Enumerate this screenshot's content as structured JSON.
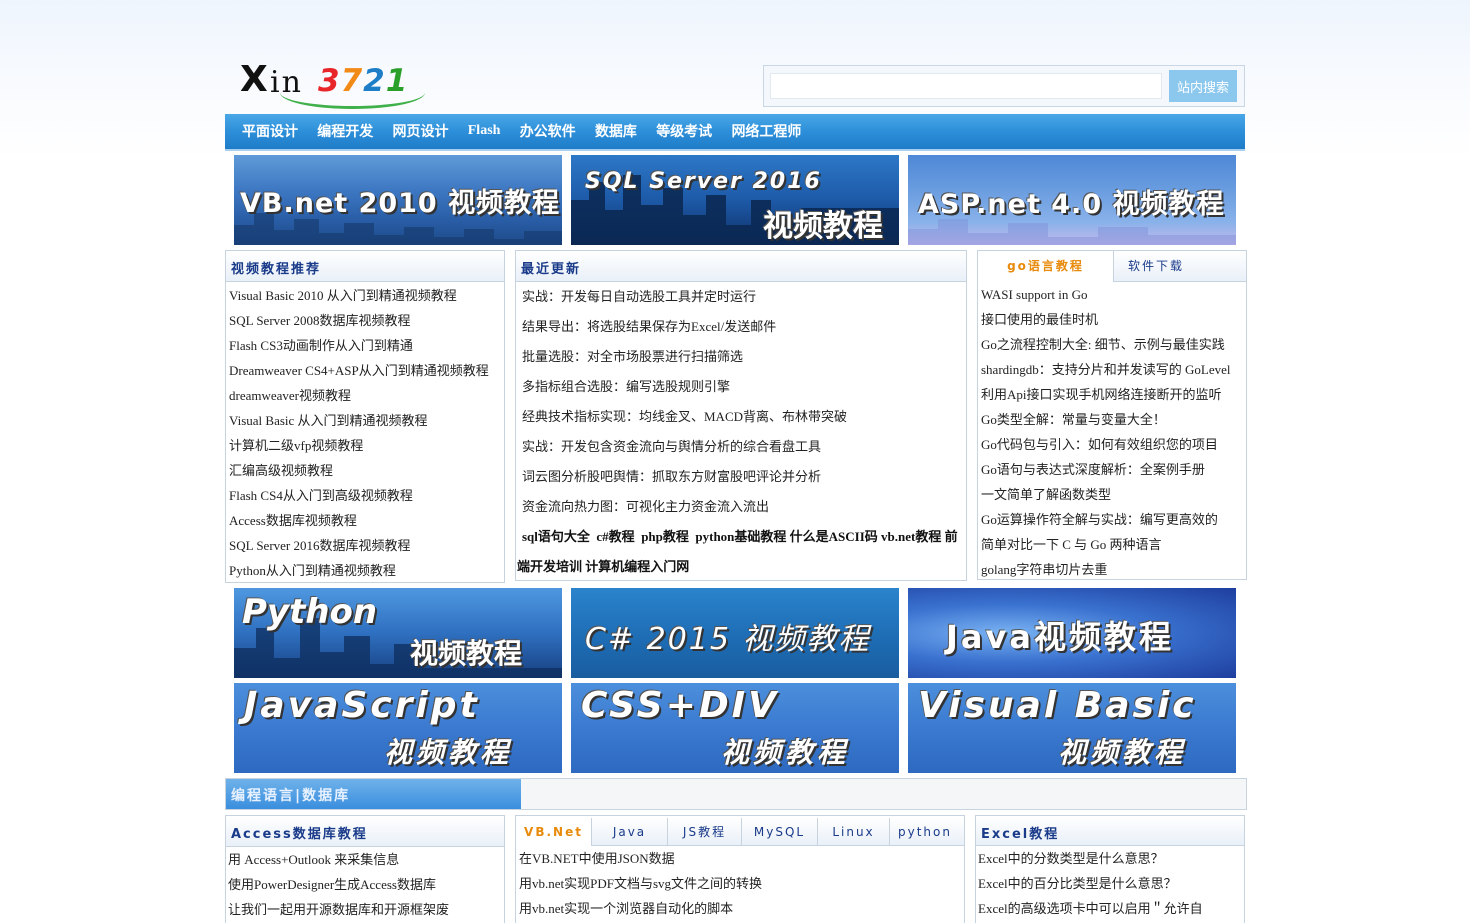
{
  "logo": {
    "x_text": "X",
    "in_text": "in",
    "num_digits": [
      "3",
      "7",
      "2",
      "1"
    ]
  },
  "search": {
    "placeholder": "",
    "button_label": "站内搜索"
  },
  "nav": {
    "items": [
      "平面设计",
      "编程开发",
      "网页设计",
      "Flash",
      "办公软件",
      "数据库",
      "等级考试",
      "网络工程师"
    ]
  },
  "banners_top": [
    {
      "line1": "VB.net 2010 视频教程",
      "line2": ""
    },
    {
      "line1": "SQL Server 2016",
      "line2": "视频教程"
    },
    {
      "line1": "ASP.net 4.0 视频教程",
      "line2": ""
    }
  ],
  "video_box": {
    "title": "视频教程推荐",
    "items": [
      "Visual Basic 2010 从入门到精通视频教程",
      "SQL Server 2008数据库视频教程",
      "Flash CS3动画制作从入门到精通",
      "Dreamweaver CS4+ASP从入门到精通视频教程",
      "dreamweaver视频教程",
      "Visual Basic 从入门到精通视频教程",
      "计算机二级vfp视频教程",
      "汇编高级视频教程",
      "Flash CS4从入门到高级视频教程",
      "Access数据库视频教程",
      "SQL Server 2016数据库视频教程",
      "Python从入门到精通视频教程"
    ]
  },
  "recent_box": {
    "title": "最近更新",
    "items": [
      "实战：开发每日自动选股工具并定时运行",
      "结果导出：将选股结果保存为Excel/发送邮件",
      "批量选股：对全市场股票进行扫描筛选",
      "多指标组合选股：编写选股规则引擎",
      "经典技术指标实现：均线金叉、MACD背离、布林带突破",
      "实战：开发包含资金流向与舆情分析的综合看盘工具",
      "词云图分析股吧舆情：抓取东方财富股吧评论并分析",
      "资金流向热力图：可视化主力资金流入流出"
    ],
    "keywords_line1": [
      "sql语句大全",
      "c#教程",
      "php教程",
      "python基础教程",
      "什么是ASCII码",
      "vb.net教程",
      "前"
    ],
    "keywords_line2": [
      "端开发培训",
      "计算机编程入门网"
    ]
  },
  "go_box": {
    "tabs": [
      "go语言教程",
      "软件下载"
    ],
    "items": [
      "WASI support in Go",
      "接口使用的最佳时机",
      "Go之流程控制大全: 细节、示例与最佳实践",
      "shardingdb：支持分片和并发读写的 GoLevel",
      "利用Api接口实现手机网络连接断开的监听",
      "Go类型全解：常量与变量大全！",
      "Go代码包与引入：如何有效组织您的项目",
      "Go语句与表达式深度解析：全案例手册",
      "一文简单了解函数类型",
      "Go运算操作符全解与实战：编写更高效的",
      "简单对比一下 C 与 Go 两种语言",
      "golang字符串切片去重"
    ]
  },
  "banners_mid": [
    {
      "line1": "Python",
      "line2": "视频教程"
    },
    {
      "line1": "C# 2015 视频教程",
      "line2": ""
    },
    {
      "line1": "Java视频教程",
      "line2": ""
    },
    {
      "line1": "JavaScript",
      "line2": "视频教程"
    },
    {
      "line1": "CSS+DIV",
      "line2": "视频教程"
    },
    {
      "line1": "Visual Basic",
      "line2": "视频教程"
    }
  ],
  "section_bar": {
    "label": "编程语言|数据库"
  },
  "access_box": {
    "title": "Access数据库教程",
    "items": [
      "用 Access+Outlook 来采集信息",
      "使用PowerDesigner生成Access数据库",
      "让我们一起用开源数据库和开源框架废"
    ]
  },
  "lang_box": {
    "tabs": [
      "VB.Net",
      "Java",
      "JS教程",
      "MySQL",
      "Linux",
      "python"
    ],
    "items": [
      "在VB.NET中使用JSON数据",
      "用vb.net实现PDF文档与svg文件之间的转换",
      "用vb.net实现一个浏览器自动化的脚本"
    ]
  },
  "excel_box": {
    "title": "Excel教程",
    "items": [
      "Excel中的分数类型是什么意思？",
      "Excel中的百分比类型是什么意思？",
      "Excel的高级选项卡中可以启用＂允许自"
    ]
  },
  "colors": {
    "nav": "#2d8fd9",
    "accent_tab": "#e88a0c",
    "title_blue": "#1a3b8a"
  }
}
